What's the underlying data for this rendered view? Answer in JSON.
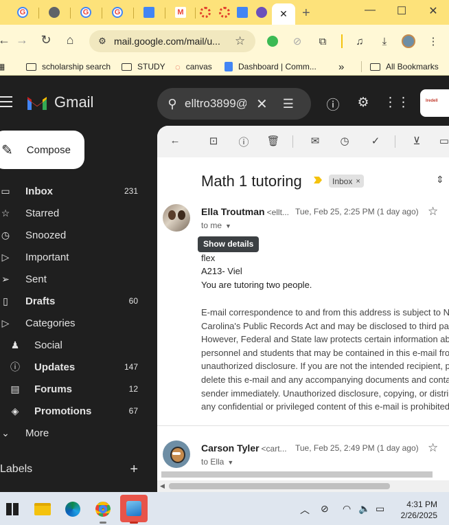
{
  "browser": {
    "tabs": [
      {
        "icon": "google-icon",
        "label": "G",
        "color": "#ea4335"
      },
      {
        "icon": "globe-icon",
        "label": "",
        "color": "#5f6368"
      },
      {
        "icon": "google-icon",
        "label": "G",
        "color": "#ea4335"
      },
      {
        "icon": "google-icon",
        "label": "G",
        "color": "#ea4335"
      },
      {
        "icon": "docs-icon",
        "label": "",
        "color": "#4285f4"
      },
      {
        "icon": "gmail-icon",
        "label": "M",
        "color": "#ea4335"
      },
      {
        "icon": "canvas-icon",
        "label": "",
        "color": "#e13f2b"
      },
      {
        "icon": "canvas-icon",
        "label": "",
        "color": "#e13f2b"
      },
      {
        "icon": "docs-icon",
        "label": "",
        "color": "#4285f4"
      },
      {
        "icon": "app-icon",
        "label": "",
        "color": "#6b4fbb"
      }
    ],
    "active_tab_close": "✕",
    "new_tab": "+",
    "url": "mail.google.com/mail/u...",
    "bookmarks": [
      {
        "label": "scholarship search"
      },
      {
        "label": "STUDY"
      },
      {
        "label": "canvas"
      },
      {
        "label": "Dashboard | Comm..."
      }
    ],
    "bookmarks_more": "»",
    "all_bookmarks": "All Bookmarks"
  },
  "gmail": {
    "brand": "Gmail",
    "search_value": "elltro3899@",
    "compose_label": "Compose",
    "nav": [
      {
        "label": "Inbox",
        "count": "231",
        "icon": "inbox-icon",
        "bold": true,
        "sub": false
      },
      {
        "label": "Starred",
        "count": "",
        "icon": "star-icon",
        "bold": false,
        "sub": false
      },
      {
        "label": "Snoozed",
        "count": "",
        "icon": "clock-icon",
        "bold": false,
        "sub": false
      },
      {
        "label": "Important",
        "count": "",
        "icon": "important-icon",
        "bold": false,
        "sub": false
      },
      {
        "label": "Sent",
        "count": "",
        "icon": "send-icon",
        "bold": false,
        "sub": false
      },
      {
        "label": "Drafts",
        "count": "60",
        "icon": "draft-icon",
        "bold": true,
        "sub": false
      },
      {
        "label": "Categories",
        "count": "",
        "icon": "label-icon",
        "bold": false,
        "sub": false
      },
      {
        "label": "Social",
        "count": "",
        "icon": "people-icon",
        "bold": false,
        "sub": true
      },
      {
        "label": "Updates",
        "count": "147",
        "icon": "info-icon",
        "bold": true,
        "sub": true
      },
      {
        "label": "Forums",
        "count": "12",
        "icon": "forum-icon",
        "bold": true,
        "sub": true
      },
      {
        "label": "Promotions",
        "count": "67",
        "icon": "tag-icon",
        "bold": true,
        "sub": true
      },
      {
        "label": "More",
        "count": "",
        "icon": "chevron-down-icon",
        "bold": false,
        "sub": false
      }
    ],
    "labels_header": "Labels",
    "labels_add": "+"
  },
  "message": {
    "subject": "Math 1 tutoring",
    "inbox_chip": "Inbox",
    "inbox_chip_close": "×",
    "tooltip": "Show details",
    "first": {
      "sender": "Ella Troutman",
      "email": "<ellt...",
      "date": "Tue, Feb 25, 2:25 PM (1 day ago)",
      "to": "to me"
    },
    "body": [
      "flex",
      "A213- Viel",
      "You are tutoring two people."
    ],
    "disclaimer": [
      "E-mail correspondence to and from this address is subject to N",
      "Carolina's Public Records Act and may be disclosed to third pa",
      "However, Federal and State law protects certain information ab",
      "personnel and students that may be contained in this e-mail fro",
      "unauthorized disclosure. If you are not the intended recipient, p",
      "delete this e-mail and any accompanying documents and conta",
      "sender immediately. Unauthorized disclosure, copying, or distri",
      "any confidential or privileged content of this e-mail is prohibited"
    ],
    "second": {
      "sender": "Carson Tyler",
      "email": "<cart...",
      "date": "Tue, Feb 25, 2:49 PM (1 day ago)",
      "to": "to Ella"
    }
  },
  "taskbar": {
    "time": "4:31 PM",
    "date": "2/26/2025"
  }
}
